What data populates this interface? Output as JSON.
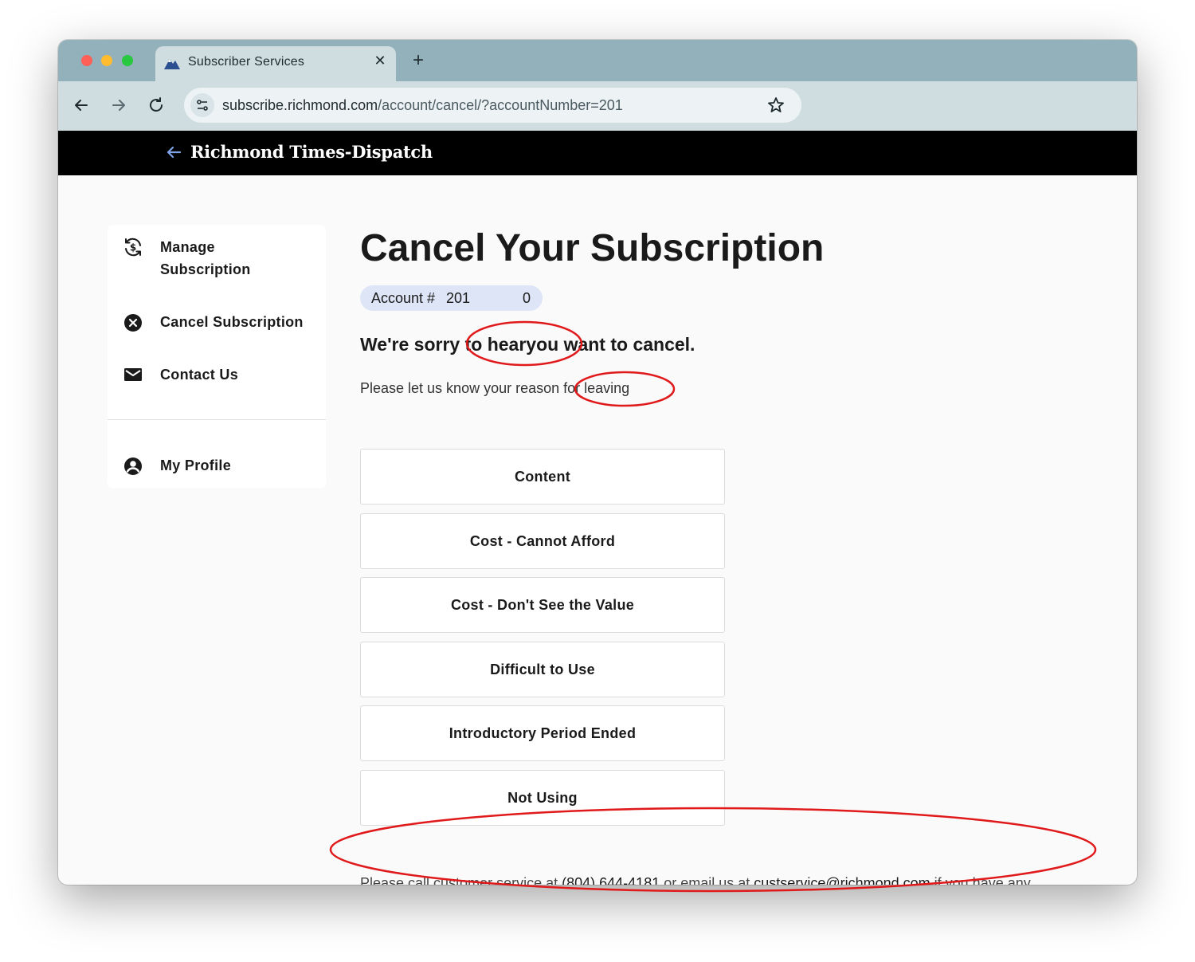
{
  "browser": {
    "tab_title": "Subscriber Services",
    "tab_close": "✕",
    "new_tab": "+",
    "url_host": "subscribe.richmond.com",
    "url_path": "/account/cancel/?accountNumber=201"
  },
  "site": {
    "logo_text": "Richmond Times-Dispatch"
  },
  "sidebar": {
    "items": [
      {
        "label": "Manage Subscription",
        "icon": "refresh-dollar-icon"
      },
      {
        "label": "Cancel Subscription",
        "icon": "x-circle-icon"
      },
      {
        "label": "Contact Us",
        "icon": "envelope-icon"
      },
      {
        "label": "My Profile",
        "icon": "user-circle-icon"
      }
    ]
  },
  "main": {
    "title": "Cancel Your Subscription",
    "account_label": "Account #",
    "account_number": "201",
    "account_suffix": "0",
    "sorry_text": "We're sorry to hearyou want to cancel.",
    "reason_prompt": "Please let us know your reason for leaving",
    "reasons": [
      "Content",
      "Cost - Cannot Afford",
      "Cost - Don't See the Value",
      "Difficult to Use",
      "Introductory Period Ended",
      "Not Using"
    ],
    "footer": {
      "prefix": "Please call customer service at",
      "phone": "(804) 644-4181",
      "middle": "or email us at",
      "email": "custservice@richmond.com",
      "suffix": "if you have any questions or concerns."
    }
  },
  "colors": {
    "tab_strip": "#92b1ba",
    "toolbar": "#cfdde1",
    "account_pill": "#dde5f7",
    "annotation": "#e0191b"
  }
}
